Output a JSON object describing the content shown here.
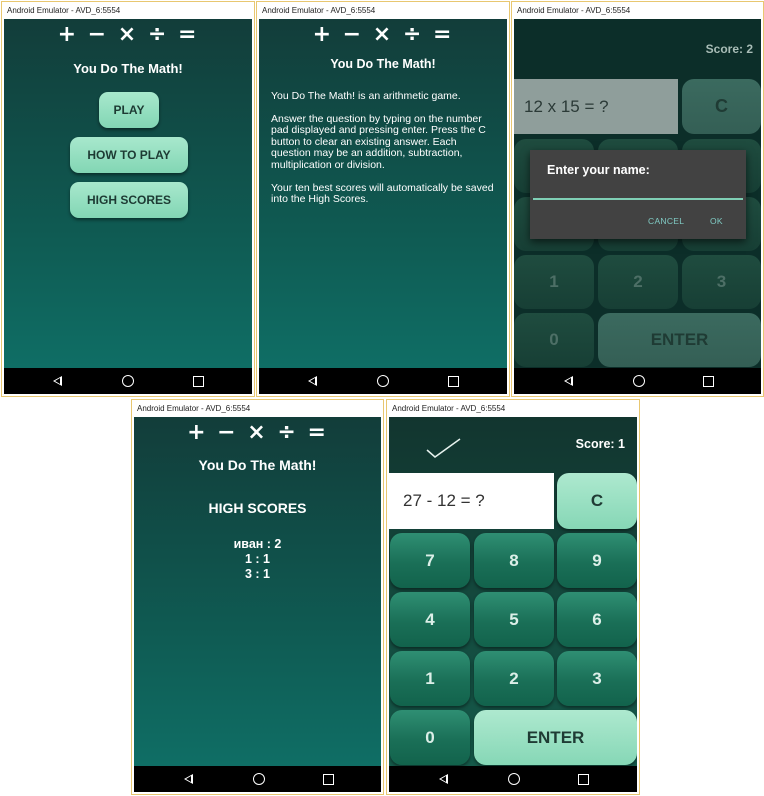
{
  "emulator_title": "Android Emulator - AVD_6:5554",
  "operators": "+ − × ÷ =",
  "app_name": "You Do The Math!",
  "menu": {
    "play": "PLAY",
    "how_to_play": "HOW TO PLAY",
    "high_scores": "HIGH SCORES"
  },
  "how_to": {
    "p1": "You Do The Math! is an arithmetic game.",
    "p2": "Answer the question by typing on the number pad displayed and pressing enter. Press the C button to clear an existing answer. Each question may be an addition, subtraction, multiplication or division.",
    "p3": "Your ten best scores will automatically be saved into the High Scores."
  },
  "name_screen": {
    "score": "Score: 2",
    "question": "12 x 15 = ?",
    "clear": "C",
    "dialog_title": "Enter your name:",
    "name_value": "",
    "cancel": "CANCEL",
    "ok": "OK",
    "keys": [
      "1",
      "2",
      "3",
      "0"
    ],
    "enter": "ENTER"
  },
  "high_scores": {
    "heading": "HIGH SCORES",
    "entries": [
      "иван : 2",
      "1 : 1",
      "3 : 1"
    ]
  },
  "game": {
    "score": "Score: 1",
    "question": "27 - 12  = ?",
    "clear": "C",
    "keys": [
      "7",
      "8",
      "9",
      "4",
      "5",
      "6",
      "1",
      "2",
      "3",
      "0"
    ],
    "enter": "ENTER",
    "feedback_icon": "check-icon"
  },
  "nav_icons": [
    "back-icon",
    "home-icon",
    "recent-apps-icon"
  ],
  "colors": {
    "screen_top": "#123d3a",
    "screen_bottom": "#0f6e65",
    "button_light": "#9ee3c6",
    "key_green": "#1f7a5f",
    "dialog_bg": "#424242",
    "dialog_accent": "#80cbc4"
  }
}
